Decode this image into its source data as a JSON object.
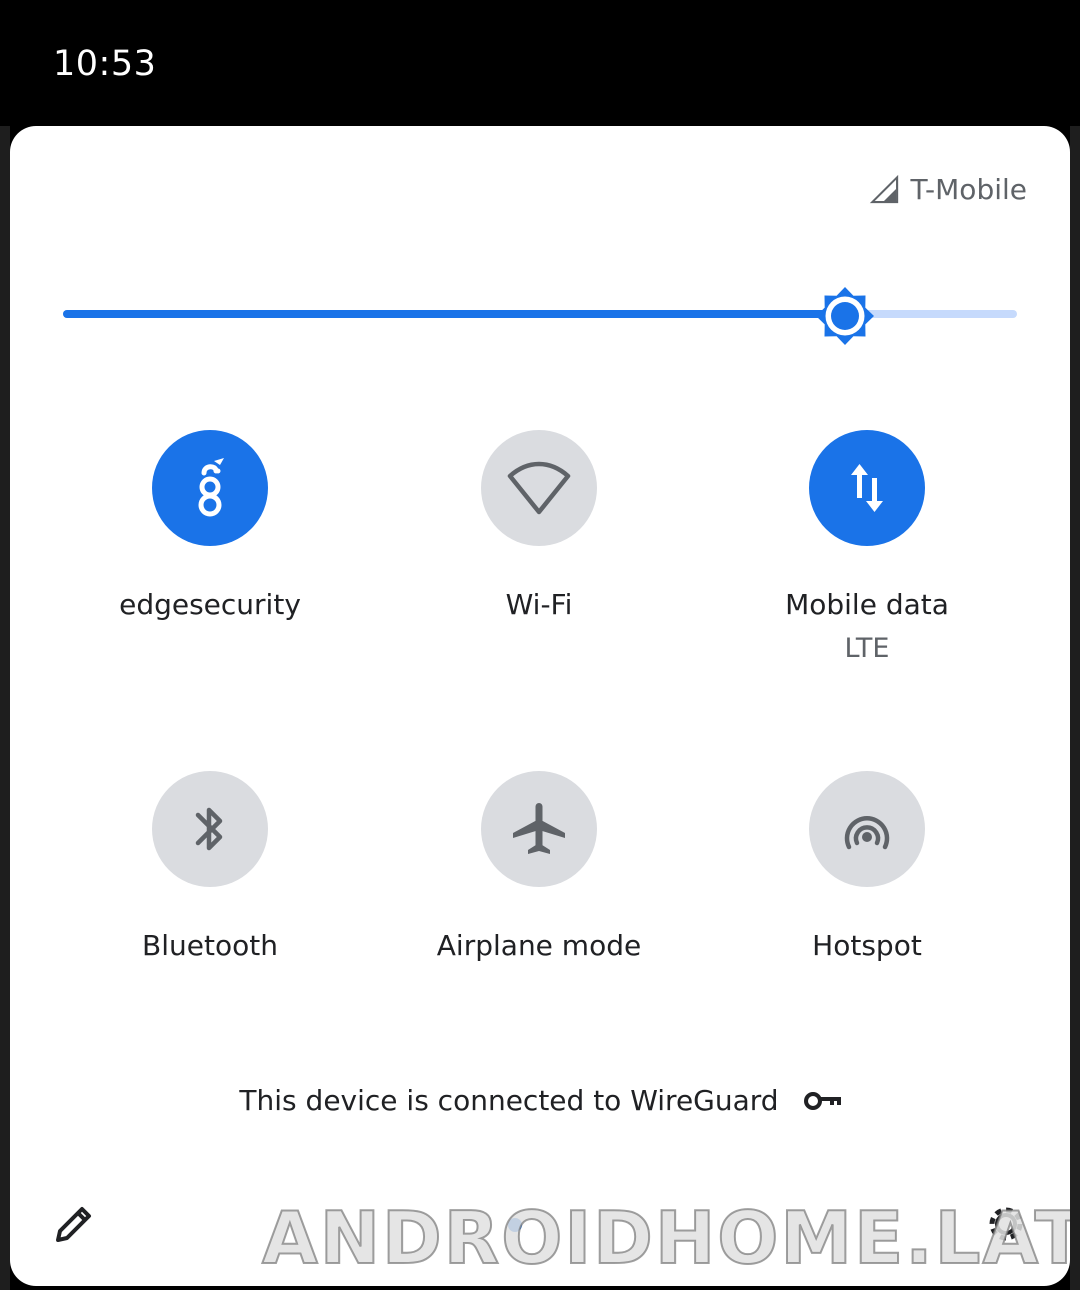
{
  "status_bar": {
    "time": "10:53"
  },
  "header": {
    "carrier": "T-Mobile",
    "signal_icon": "cell-signal-icon"
  },
  "brightness": {
    "level_percent": 82,
    "icon": "brightness-sun-icon"
  },
  "tiles": [
    {
      "label": "edgesecurity",
      "sublabel": "",
      "icon": "wireguard-icon",
      "active": true
    },
    {
      "label": "Wi-Fi",
      "sublabel": "",
      "icon": "wifi-icon",
      "active": false
    },
    {
      "label": "Mobile data",
      "sublabel": "LTE",
      "icon": "mobile-data-icon",
      "active": true
    },
    {
      "label": "Bluetooth",
      "sublabel": "",
      "icon": "bluetooth-icon",
      "active": false
    },
    {
      "label": "Airplane mode",
      "sublabel": "",
      "icon": "airplane-icon",
      "active": false
    },
    {
      "label": "Hotspot",
      "sublabel": "",
      "icon": "hotspot-icon",
      "active": false
    }
  ],
  "footer": {
    "vpn_text": "This device is connected to WireGuard",
    "vpn_icon": "vpn-key-icon",
    "edit_icon": "pencil-icon",
    "settings_icon": "gear-icon"
  },
  "watermark": "ANDROIDHOME.LAT",
  "colors": {
    "accent": "#1a73e8",
    "accent_light": "#c6dafc",
    "tile_off": "#dadce0",
    "icon_off": "#5f6368",
    "panel": "#ffffff"
  }
}
